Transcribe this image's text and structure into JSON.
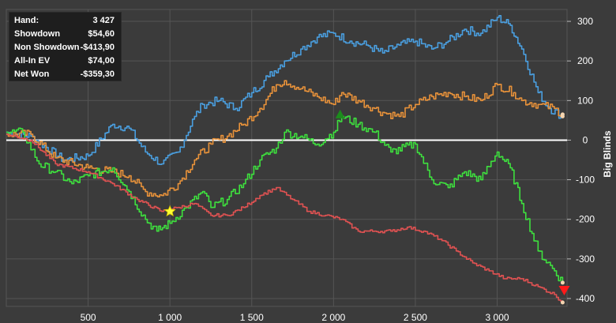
{
  "stats": {
    "rows": [
      {
        "label": "Hand:",
        "value": "3 427"
      },
      {
        "label": "Showdown",
        "value": "$54,60"
      },
      {
        "label": "Non Showdown",
        "value": "-$413,90"
      },
      {
        "label": "All-In EV",
        "value": "$74,00"
      },
      {
        "label": "Net Won",
        "value": "-$359,30"
      }
    ]
  },
  "chart_data": {
    "type": "line",
    "ylabel": "Big Blinds",
    "xlim": [
      0,
      3427
    ],
    "ylim": [
      -420,
      330
    ],
    "x_ticks": [
      500,
      1000,
      1500,
      2000,
      2500,
      3000
    ],
    "x_tick_labels": [
      "500",
      "1 000",
      "1 500",
      "2 000",
      "2 500",
      "3 000"
    ],
    "y_ticks": [
      300,
      200,
      100,
      0,
      -100,
      -200,
      -300,
      -400
    ],
    "y_tick_labels": [
      "300",
      "200",
      "100",
      "0",
      "-100",
      "-200",
      "-300",
      "-400"
    ],
    "grid": true,
    "y_axis_position": "right",
    "colors": {
      "background": "#3b3b3b",
      "grid": "#555555",
      "zero_line": "#ffffff"
    },
    "series": [
      {
        "color": "#4a9fe0",
        "points": [
          [
            0,
            20
          ],
          [
            150,
            10
          ],
          [
            350,
            -50
          ],
          [
            500,
            -40
          ],
          [
            650,
            40
          ],
          [
            750,
            30
          ],
          [
            850,
            -30
          ],
          [
            950,
            -60
          ],
          [
            1050,
            -30
          ],
          [
            1150,
            60
          ],
          [
            1200,
            90
          ],
          [
            1300,
            100
          ],
          [
            1400,
            80
          ],
          [
            1500,
            120
          ],
          [
            1600,
            160
          ],
          [
            1700,
            200
          ],
          [
            1800,
            230
          ],
          [
            1900,
            260
          ],
          [
            2000,
            270
          ],
          [
            2100,
            250
          ],
          [
            2200,
            240
          ],
          [
            2300,
            220
          ],
          [
            2400,
            240
          ],
          [
            2500,
            250
          ],
          [
            2600,
            230
          ],
          [
            2700,
            250
          ],
          [
            2800,
            280
          ],
          [
            2900,
            270
          ],
          [
            3000,
            310
          ],
          [
            3080,
            290
          ],
          [
            3150,
            230
          ],
          [
            3250,
            120
          ],
          [
            3320,
            80
          ],
          [
            3400,
            60
          ]
        ]
      },
      {
        "color": "#e8923a",
        "points": [
          [
            0,
            15
          ],
          [
            150,
            15
          ],
          [
            300,
            -45
          ],
          [
            500,
            -70
          ],
          [
            650,
            -80
          ],
          [
            750,
            -90
          ],
          [
            850,
            -130
          ],
          [
            950,
            -140
          ],
          [
            1050,
            -110
          ],
          [
            1150,
            -50
          ],
          [
            1250,
            -10
          ],
          [
            1350,
            10
          ],
          [
            1450,
            40
          ],
          [
            1550,
            80
          ],
          [
            1650,
            140
          ],
          [
            1700,
            150
          ],
          [
            1800,
            130
          ],
          [
            1900,
            110
          ],
          [
            2000,
            90
          ],
          [
            2050,
            120
          ],
          [
            2150,
            100
          ],
          [
            2250,
            80
          ],
          [
            2300,
            70
          ],
          [
            2400,
            60
          ],
          [
            2500,
            90
          ],
          [
            2600,
            110
          ],
          [
            2700,
            120
          ],
          [
            2800,
            110
          ],
          [
            2900,
            100
          ],
          [
            3000,
            140
          ],
          [
            3100,
            120
          ],
          [
            3150,
            100
          ],
          [
            3250,
            90
          ],
          [
            3350,
            80
          ],
          [
            3400,
            65
          ]
        ]
      },
      {
        "color": "#3ee03e",
        "points": [
          [
            0,
            20
          ],
          [
            100,
            20
          ],
          [
            200,
            -60
          ],
          [
            300,
            -80
          ],
          [
            400,
            -110
          ],
          [
            500,
            -90
          ],
          [
            650,
            -70
          ],
          [
            750,
            -130
          ],
          [
            850,
            -200
          ],
          [
            920,
            -230
          ],
          [
            1000,
            -210
          ],
          [
            1100,
            -170
          ],
          [
            1200,
            -130
          ],
          [
            1250,
            -170
          ],
          [
            1350,
            -150
          ],
          [
            1450,
            -110
          ],
          [
            1550,
            -50
          ],
          [
            1650,
            -20
          ],
          [
            1700,
            20
          ],
          [
            1800,
            10
          ],
          [
            1900,
            -10
          ],
          [
            2000,
            20
          ],
          [
            2050,
            60
          ],
          [
            2150,
            40
          ],
          [
            2250,
            20
          ],
          [
            2350,
            -30
          ],
          [
            2500,
            -10
          ],
          [
            2600,
            -100
          ],
          [
            2700,
            -120
          ],
          [
            2800,
            -80
          ],
          [
            2900,
            -100
          ],
          [
            3000,
            -30
          ],
          [
            3080,
            -70
          ],
          [
            3150,
            -160
          ],
          [
            3250,
            -280
          ],
          [
            3350,
            -330
          ],
          [
            3400,
            -360
          ]
        ]
      },
      {
        "color": "#e05252",
        "points": [
          [
            0,
            15
          ],
          [
            150,
            0
          ],
          [
            300,
            -60
          ],
          [
            500,
            -80
          ],
          [
            650,
            -110
          ],
          [
            800,
            -150
          ],
          [
            950,
            -180
          ],
          [
            1050,
            -170
          ],
          [
            1150,
            -160
          ],
          [
            1250,
            -190
          ],
          [
            1350,
            -190
          ],
          [
            1450,
            -170
          ],
          [
            1550,
            -140
          ],
          [
            1650,
            -120
          ],
          [
            1750,
            -150
          ],
          [
            1850,
            -180
          ],
          [
            1950,
            -190
          ],
          [
            2050,
            -200
          ],
          [
            2150,
            -230
          ],
          [
            2250,
            -230
          ],
          [
            2350,
            -230
          ],
          [
            2450,
            -220
          ],
          [
            2550,
            -230
          ],
          [
            2650,
            -250
          ],
          [
            2750,
            -280
          ],
          [
            2850,
            -310
          ],
          [
            2950,
            -330
          ],
          [
            3050,
            -350
          ],
          [
            3150,
            -350
          ],
          [
            3250,
            -370
          ],
          [
            3350,
            -390
          ],
          [
            3400,
            -410
          ]
        ]
      }
    ]
  }
}
